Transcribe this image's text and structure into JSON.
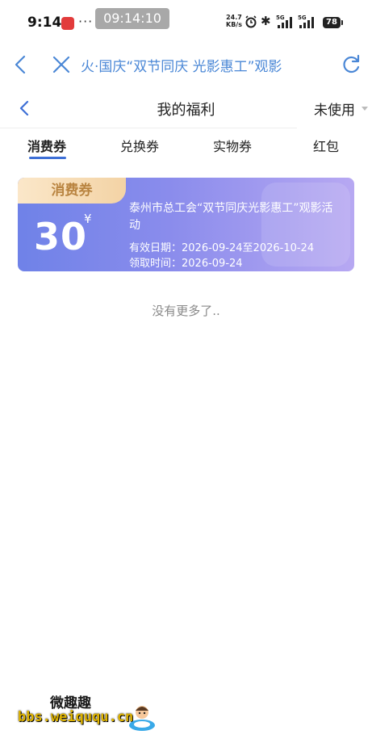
{
  "status_bar": {
    "time": "9:14",
    "dots": "···",
    "clock_pill": "09:14:10",
    "net_speed_value": "24.7",
    "net_speed_unit": "KB/s",
    "sig1_label": "5G",
    "sig2_label": "5G",
    "battery": "78"
  },
  "browser_bar": {
    "title": "火·国庆“双节同庆 光影惠工”观影"
  },
  "page_header": {
    "title": "我的福利",
    "filter": "未使用"
  },
  "tabs": [
    {
      "label": "消费券"
    },
    {
      "label": "兑换券"
    },
    {
      "label": "实物券"
    },
    {
      "label": "红包"
    }
  ],
  "coupon": {
    "tag": "消费券",
    "amount": "30",
    "currency": "¥",
    "name": "泰州市总工会“双节同庆光影惠工”观影活动",
    "valid_period": "有效日期：2026-09-24至2026-10-24",
    "claim_time": "领取时间：2026-09-24"
  },
  "no_more": "没有更多了..",
  "watermark": {
    "top": "微趣趣",
    "url": "bbs.weiququ.cn"
  },
  "colors": {
    "accent": "#3d6fd6",
    "browser_link": "#4a87d6",
    "coupon_start": "#6f82e8",
    "coupon_end": "#b7a8f2",
    "coupon_tag": "#f3d3a5"
  }
}
